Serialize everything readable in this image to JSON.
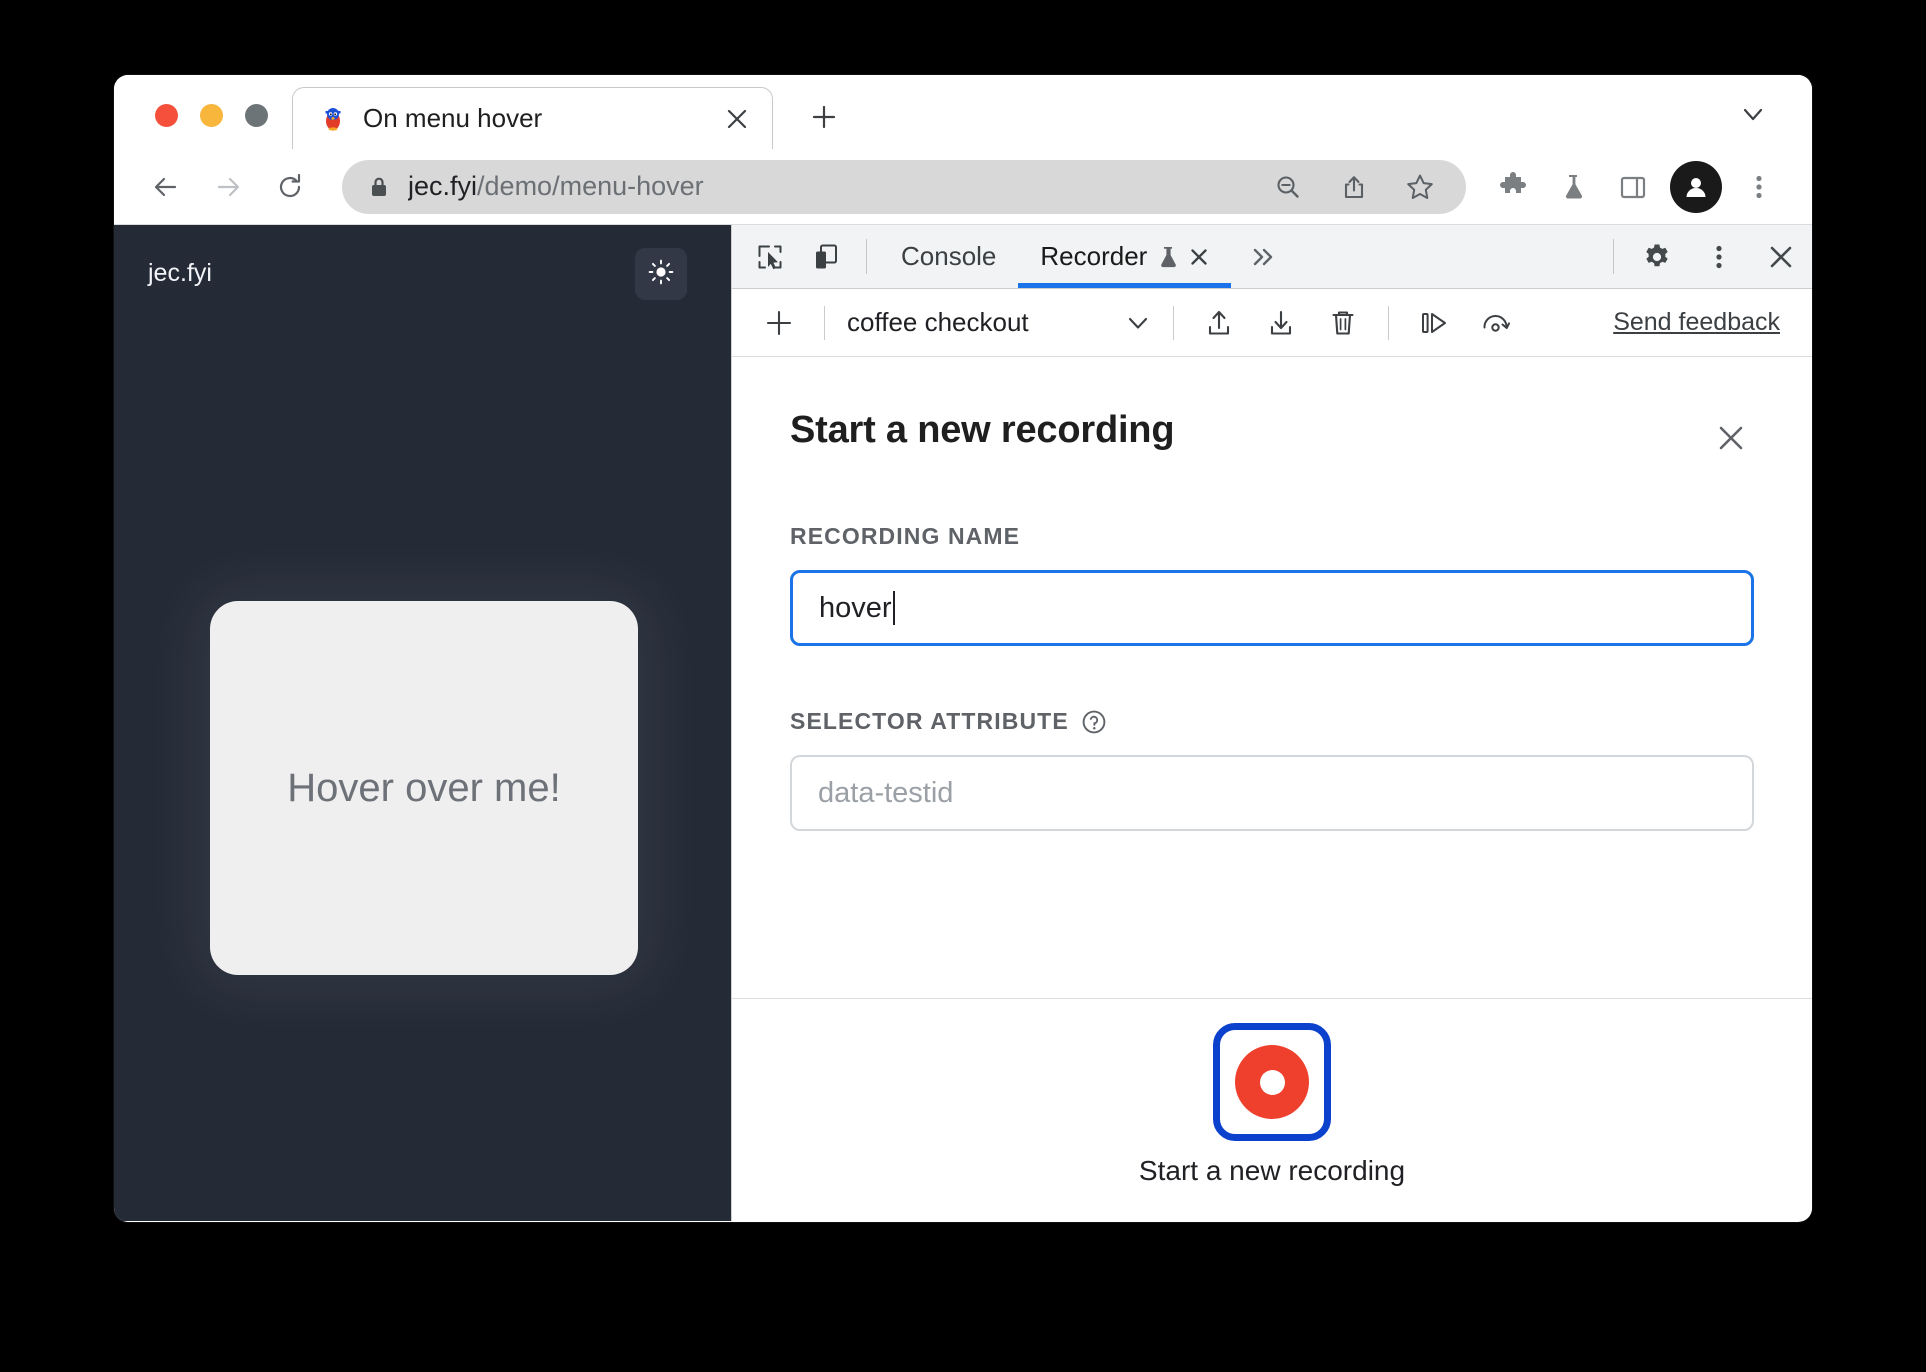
{
  "browser": {
    "tab": {
      "title": "On menu hover",
      "favicon_name": "penguin-favicon",
      "close_label": "✕"
    },
    "new_tab_label": "+",
    "tabstrip_chevron_label": "⌄",
    "toolbar": {
      "back_label": "←",
      "forward_label": "→",
      "reload_label": "↻",
      "lock_name": "lock-icon",
      "url_domain": "jec.fyi",
      "url_path": "/demo/menu-hover",
      "zoom_out_name": "zoom-out-icon",
      "share_name": "share-icon",
      "bookmark_name": "star-icon",
      "extensions_name": "puzzle-icon",
      "experiments_name": "flask-icon",
      "side_panel_name": "side-panel-icon",
      "profile_name": "avatar-icon",
      "menu_label": "⋮"
    }
  },
  "page": {
    "brand": "jec.fyi",
    "theme_toggle_name": "sun-icon",
    "card_label": "Hover over me!",
    "background": "#242a36",
    "card_background": "#efefef"
  },
  "devtools": {
    "tabbar": {
      "inspect_name": "inspect-element-icon",
      "device_name": "device-toolbar-icon",
      "tabs": [
        {
          "label": "Console",
          "active": false
        },
        {
          "label": "Recorder",
          "active": true,
          "experimental": true,
          "closeable": true
        }
      ],
      "overflow_label": "»",
      "settings_name": "gear-icon",
      "more_label": "⋮",
      "close_label": "✕",
      "accent": "#1a73e8"
    },
    "recorder_toolbar": {
      "add_label": "+",
      "selected_recording": "coffee checkout",
      "dropdown_chevron": "∨",
      "export_name": "export-icon",
      "import_name": "import-icon",
      "delete_name": "trash-icon",
      "step_replay_name": "step-replay-icon",
      "performance_replay_name": "performance-replay-icon",
      "feedback_label": "Send feedback"
    },
    "form": {
      "title": "Start a new recording",
      "close_label": "✕",
      "recording_name_label": "RECORDING NAME",
      "recording_name_value": "hover",
      "selector_attribute_label": "SELECTOR ATTRIBUTE",
      "selector_help_name": "help-icon",
      "selector_attribute_placeholder": "data-testid",
      "start_button_label": "Start a new recording",
      "record_color": "#ee402d",
      "focus_color": "#0b41cd"
    }
  }
}
